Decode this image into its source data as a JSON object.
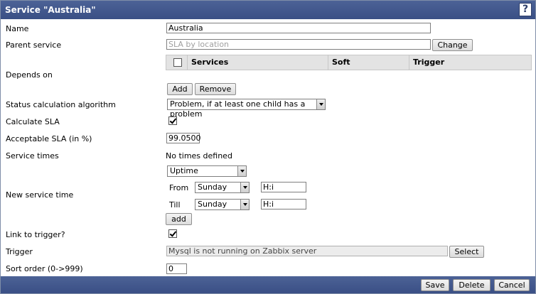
{
  "window": {
    "title": "Service \"Australia\"",
    "help_label": "?"
  },
  "fields": {
    "name": {
      "label": "Name",
      "value": "Australia"
    },
    "parent": {
      "label": "Parent service",
      "placeholder": "SLA by location",
      "change_label": "Change"
    },
    "depends": {
      "label": "Depends on",
      "columns": [
        "Services",
        "Soft",
        "Trigger"
      ],
      "add_label": "Add",
      "remove_label": "Remove"
    },
    "algorithm": {
      "label": "Status calculation algorithm",
      "value": "Problem, if at least one child has a problem"
    },
    "calc_sla": {
      "label": "Calculate SLA",
      "checked": true
    },
    "acceptable_sla": {
      "label": "Acceptable SLA (in %)",
      "value": "99.0500"
    },
    "service_times": {
      "label": "Service times",
      "value": "No times defined"
    },
    "new_time": {
      "label": "New service time",
      "type_value": "Uptime",
      "from_label": "From",
      "from_day": "Sunday",
      "from_time": "H:i",
      "till_label": "Till",
      "till_day": "Sunday",
      "till_time": "H:i",
      "add_label": "add"
    },
    "link_trigger": {
      "label": "Link to trigger?",
      "checked": true
    },
    "trigger": {
      "label": "Trigger",
      "value": "Mysql is not running on Zabbix server",
      "select_label": "Select"
    },
    "sort_order": {
      "label": "Sort order (0->999)",
      "value": "0"
    }
  },
  "footer": {
    "save_label": "Save",
    "delete_label": "Delete",
    "cancel_label": "Cancel"
  }
}
